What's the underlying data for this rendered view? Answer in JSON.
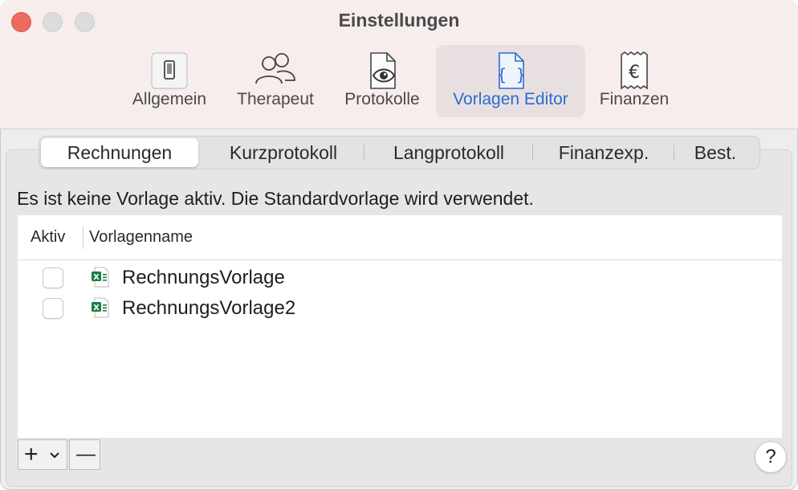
{
  "window": {
    "title": "Einstellungen"
  },
  "toolbar": {
    "items": [
      {
        "label": "Allgemein",
        "icon": "switch-icon"
      },
      {
        "label": "Therapeut",
        "icon": "people-icon"
      },
      {
        "label": "Protokolle",
        "icon": "document-eye-icon"
      },
      {
        "label": "Vorlagen Editor",
        "icon": "curly-braces-document-icon",
        "selected": true
      },
      {
        "label": "Finanzen",
        "icon": "euro-receipt-icon"
      }
    ]
  },
  "tabs": [
    {
      "label": "Rechnungen",
      "active": true
    },
    {
      "label": "Kurzprotokoll"
    },
    {
      "label": "Langprotokoll"
    },
    {
      "label": "Finanzexp."
    },
    {
      "label": "Best."
    }
  ],
  "info_text": "Es ist keine Vorlage aktiv. Die Standardvorlage wird verwendet.",
  "table": {
    "columns": [
      "Aktiv",
      "Vorlagenname"
    ],
    "rows": [
      {
        "active": false,
        "name": "RechnungsVorlage",
        "icon": "excel-file-icon"
      },
      {
        "active": false,
        "name": "RechnungsVorlage2",
        "icon": "excel-file-icon"
      }
    ]
  },
  "buttons": {
    "add_symbol": "+",
    "remove_symbol": "—",
    "help_symbol": "?"
  },
  "colors": {
    "accent": "#2b6cd4",
    "close": "#ed6a5e",
    "excel_green": "#1e7b45"
  }
}
